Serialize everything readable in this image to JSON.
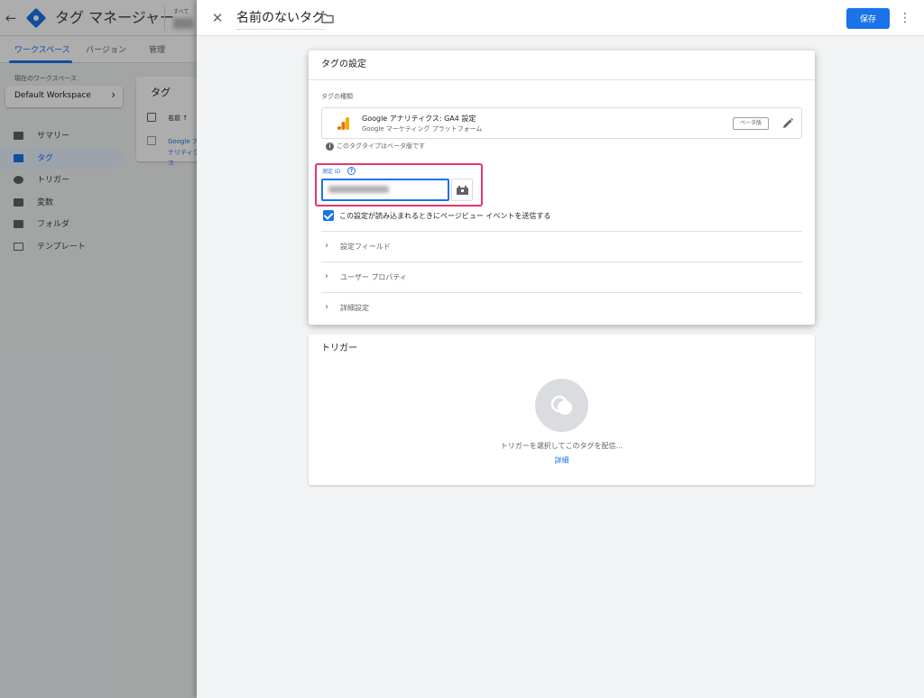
{
  "background": {
    "app_title": "タグ マネージャー",
    "account_label": "すべて",
    "tabs": [
      "ワークスペース",
      "バージョン",
      "管理"
    ],
    "workspace_label": "現在のワークスペース",
    "workspace_name": "Default Workspace",
    "nav": [
      "サマリー",
      "タグ",
      "トリガー",
      "変数",
      "フォルダ",
      "テンプレート"
    ],
    "tags_card": {
      "title": "タグ",
      "column_name": "名前 ↑",
      "row_name": "Google アナリティクス"
    }
  },
  "panel": {
    "tag_name": "名前のないタグ",
    "save_label": "保存"
  },
  "config": {
    "title": "タグの設定",
    "tag_type_label": "タグの種類",
    "tag_type_name": "Google アナリティクス: GA4 設定",
    "tag_type_sub": "Google マーケティング プラットフォーム",
    "beta_badge": "ベータ版",
    "beta_note": "このタグタイプはベータ版です",
    "measurement_label": "測定 ID",
    "pageview_label": "この設定が読み込まれるときにページビュー イベントを送信する",
    "pageview_checked": true,
    "expanders": [
      "設定フィールド",
      "ユーザー プロパティ",
      "詳細設定"
    ]
  },
  "trigger": {
    "title": "トリガー",
    "hint": "トリガーを選択してこのタグを配信...",
    "details_link": "詳細"
  },
  "colors": {
    "accent": "#1a73e8",
    "highlight": "#e8356d",
    "ga_orange": "#f9ab00",
    "ga_dark_orange": "#e37400"
  },
  "icons": [
    "close-icon",
    "folder-icon",
    "more-vert-icon",
    "ga-icon",
    "edit-icon",
    "info-icon",
    "help-icon",
    "variable-picker-icon",
    "chevron-right-icon",
    "trigger-placeholder-icon"
  ]
}
